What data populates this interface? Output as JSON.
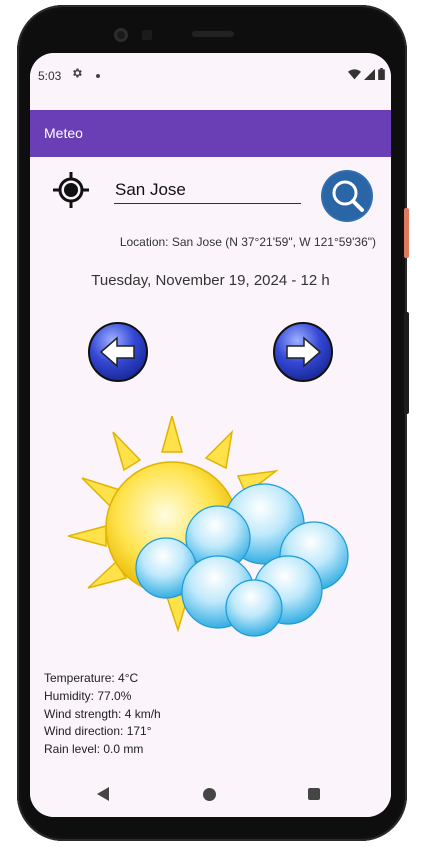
{
  "status_bar": {
    "time": "5:03"
  },
  "app_bar": {
    "title": "Meteo"
  },
  "search": {
    "value": "San Jose"
  },
  "location_label": "Location: San Jose (N 37°21'59\", W 121°59'36\")",
  "date_label": "Tuesday, November 19, 2024 - 12 h",
  "weather": {
    "condition_icon": "partly-cloudy-icon",
    "temperature": "Temperature: 4°C",
    "humidity": "Humidity: 77.0%",
    "wind_strength": "Wind strength: 4 km/h",
    "wind_direction": "Wind direction: 171°",
    "rain_level": "Rain level: 0.0 mm"
  },
  "colors": {
    "app_bar": "#6a3fb5",
    "background": "#fbf4fb",
    "search_button": "#2f6fb0",
    "arrow_blue": "#2a3fc4"
  }
}
